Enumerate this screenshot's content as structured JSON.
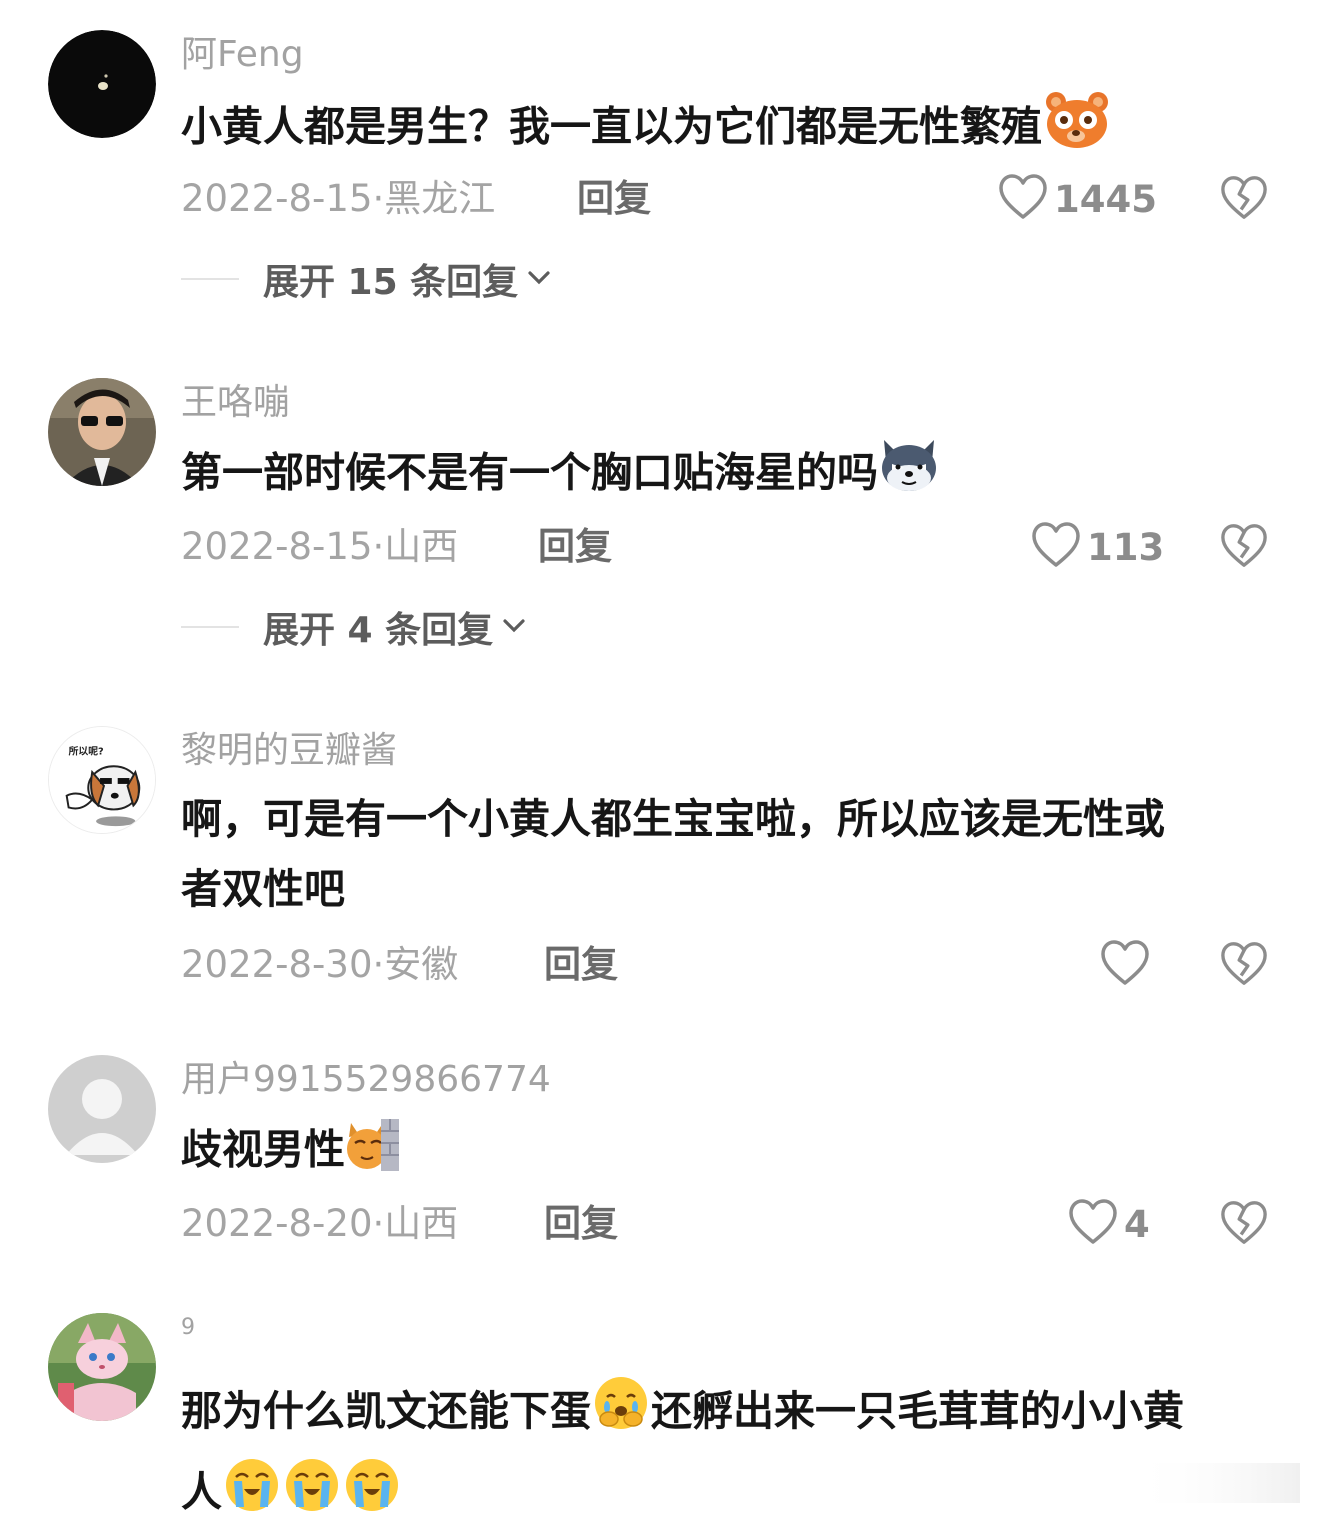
{
  "comments": [
    {
      "username": "阿Feng",
      "text": "小黄人都是男生？我一直以为它们都是无性繁殖",
      "date": "2022-8-15",
      "location": "黑龙江",
      "reply_label": "回复",
      "likes": "1445",
      "expand_label": "展开 15 条回复"
    },
    {
      "username": "王咯嘣",
      "text": "第一部时候不是有一个胸口贴海星的吗",
      "date": "2022-8-15",
      "location": "山西",
      "reply_label": "回复",
      "likes": "113",
      "expand_label": "展开 4 条回复"
    },
    {
      "username": "黎明的豆瓣酱",
      "text_line1": "啊，可是有一个小黄人都生宝宝啦，所以应该是无性或",
      "text_line2": "者双性吧",
      "date": "2022-8-30",
      "location": "安徽",
      "reply_label": "回复",
      "likes": "",
      "avatar_caption": "所以呢?"
    },
    {
      "username": "用户9915529866774",
      "text": "歧视男性",
      "date": "2022-8-20",
      "location": "山西",
      "reply_label": "回复",
      "likes": "4"
    },
    {
      "username": "9",
      "text_part1": "那为什么凯文还能下蛋",
      "text_part2": "还孵出来一只毛茸茸的小小黄",
      "text_line2": "人"
    }
  ],
  "icons": {
    "like": "heart-outline-icon",
    "dislike": "broken-heart-icon",
    "expand": "chevron-down-icon"
  },
  "colors": {
    "text": "#161616",
    "muted": "#a2a2a2",
    "reply": "#6a6a6a"
  }
}
